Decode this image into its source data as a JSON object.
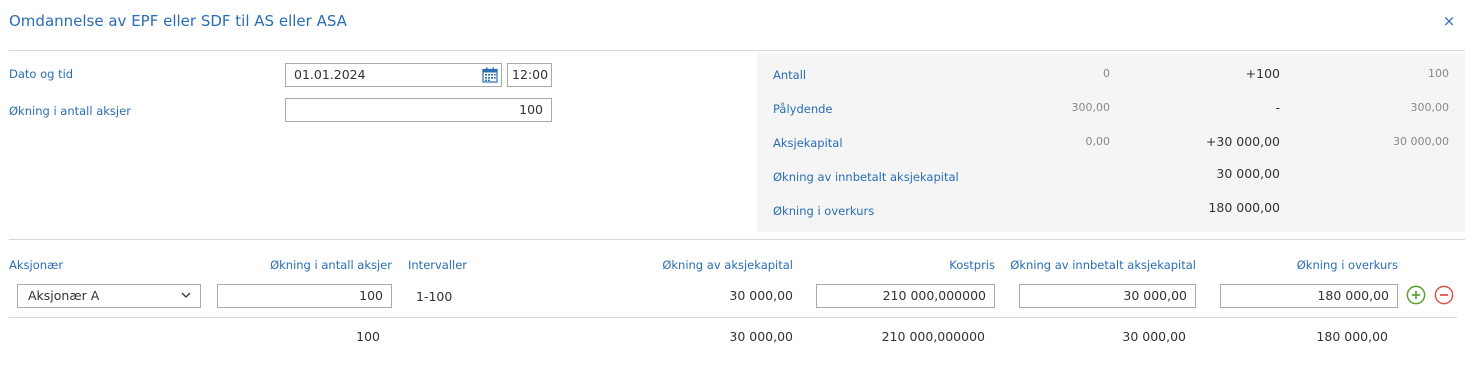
{
  "dialog": {
    "title": "Omdannelse av EPF eller SDF til AS eller ASA",
    "close_glyph": "×"
  },
  "form": {
    "date_label": "Dato og tid",
    "date_value": "01.01.2024",
    "time_value": "12:00",
    "shares_label": "Økning i antall aksjer",
    "shares_value": "100"
  },
  "summary": {
    "rows": [
      {
        "label": "Antall",
        "before": "0",
        "change": "+100",
        "after": "100"
      },
      {
        "label": "Pålydende",
        "before": "300,00",
        "change": "-",
        "after": "300,00"
      },
      {
        "label": "Aksjekapital",
        "before": "0,00",
        "change": "+30 000,00",
        "after": "30 000,00"
      },
      {
        "label": "Økning av innbetalt aksjekapital",
        "change": "30 000,00"
      },
      {
        "label": "Økning i overkurs",
        "change": "180 000,00"
      }
    ]
  },
  "table": {
    "headers": {
      "shareholder": "Aksjonær",
      "share_increase": "Økning i antall aksjer",
      "intervals": "Intervaller",
      "capital_increase": "Økning av aksjekapital",
      "cost_price": "Kostpris",
      "paid_in_capital": "Økning av innbetalt aksjekapital",
      "premium": "Økning i overkurs"
    },
    "row": {
      "shareholder": "Aksjonær A",
      "share_increase": "100",
      "intervals": "1-100",
      "capital_increase": "30 000,00",
      "cost_price": "210 000,000000",
      "paid_in_capital": "30 000,00",
      "premium": "180 000,00"
    },
    "totals": {
      "share_increase": "100",
      "capital_increase": "30 000,00",
      "cost_price": "210 000,000000",
      "paid_in_capital": "30 000,00",
      "premium": "180 000,00"
    }
  },
  "icons": {
    "calendar": "calendar-icon",
    "dropdown": "chevron-down-icon",
    "add": "plus-circle-icon",
    "remove": "minus-circle-icon"
  },
  "colors": {
    "accent": "#2a6db5",
    "add": "#5aa02c",
    "remove": "#d9534f",
    "panel": "#f5f5f5"
  }
}
